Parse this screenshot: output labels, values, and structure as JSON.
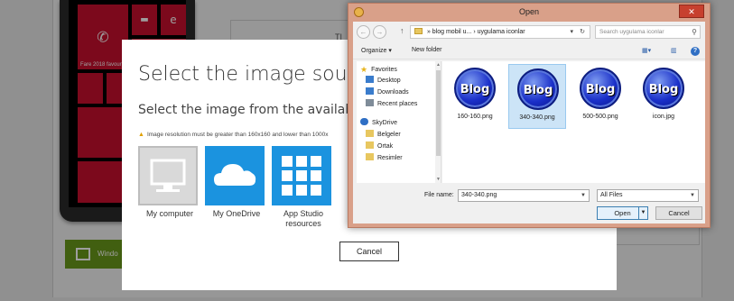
{
  "background": {
    "phone_tile_label": "Fare 2018 favourite",
    "page_label": "TI",
    "green_button_label": "Windo"
  },
  "source_dialog": {
    "title": "Select the image source",
    "subtitle": "Select the image from the available so",
    "warning": "Image resolution must be greater than 160x160 and lower than 1000x",
    "options": [
      {
        "label": "My computer",
        "icon": "monitor-icon",
        "color": "#d9d9d9"
      },
      {
        "label": "My OneDrive",
        "icon": "cloud-icon",
        "color": "#1b93df"
      },
      {
        "label": "App Studio resources",
        "icon": "grid-icon",
        "color": "#1b93df"
      }
    ],
    "cancel_label": "Cancel"
  },
  "open_dialog": {
    "title": "Open",
    "close_label": "✕",
    "address": {
      "segments": [
        "blog mobil u...",
        "uygulama iconlar"
      ]
    },
    "search_placeholder": "Search uygulama iconlar",
    "toolbar": {
      "organize_label": "Organize ▾",
      "new_folder_label": "New folder"
    },
    "nav": [
      {
        "label": "Favorites",
        "icon": "star-icon",
        "indent": 0
      },
      {
        "label": "Desktop",
        "icon": "desktop-icon",
        "indent": 1
      },
      {
        "label": "Downloads",
        "icon": "downloads-icon",
        "indent": 1
      },
      {
        "label": "Recent places",
        "icon": "recent-places-icon",
        "indent": 1
      },
      {
        "label": "SkyDrive",
        "icon": "skydrive-icon",
        "indent": 0
      },
      {
        "label": "Belgeler",
        "icon": "folder-icon",
        "indent": 1
      },
      {
        "label": "Ortak",
        "icon": "folder-icon",
        "indent": 1
      },
      {
        "label": "Resimler",
        "icon": "folder-icon",
        "indent": 1
      }
    ],
    "files": [
      {
        "name": "160-160.png",
        "badge": "Blog",
        "selected": false
      },
      {
        "name": "340-340.png",
        "badge": "Blog",
        "selected": true
      },
      {
        "name": "500-500.png",
        "badge": "Blog",
        "selected": false
      },
      {
        "name": "icon.jpg",
        "badge": "Blog",
        "selected": false
      }
    ],
    "file_name_label": "File name:",
    "file_name_value": "340-340.png",
    "file_type_value": "All Files",
    "open_label": "Open",
    "cancel_label": "Cancel"
  }
}
